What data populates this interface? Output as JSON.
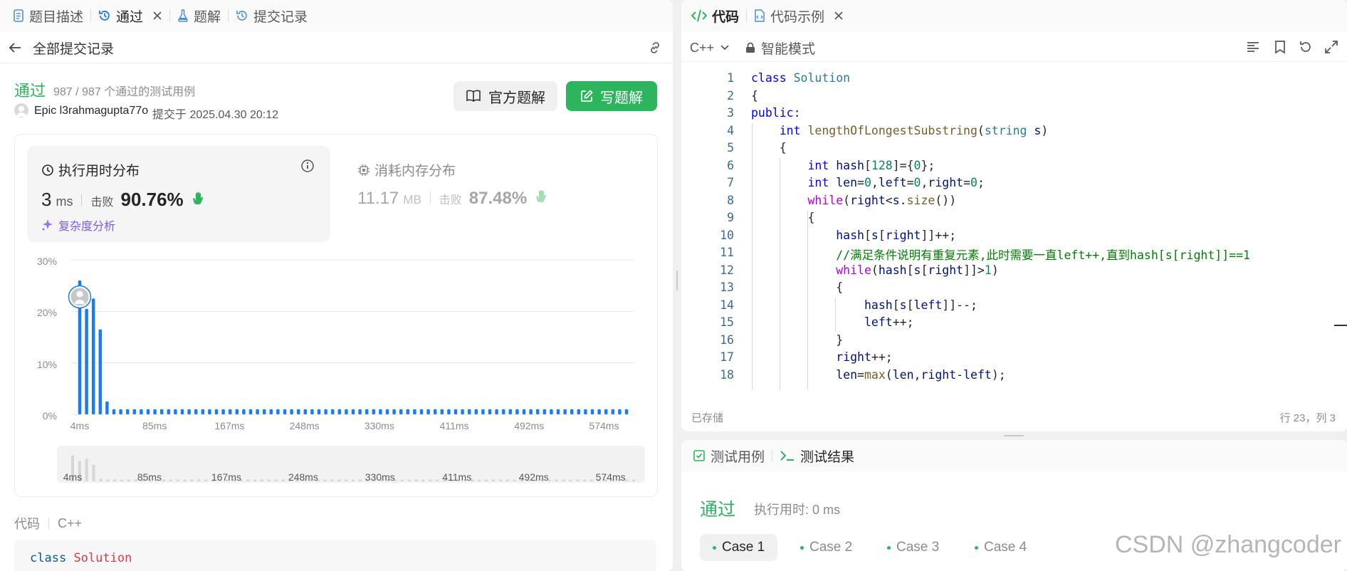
{
  "left": {
    "tabs": [
      {
        "label": "题目描述",
        "icon": "doc-icon"
      },
      {
        "label": "通过",
        "icon": "history-icon",
        "closable": true
      },
      {
        "label": "题解",
        "icon": "flask-icon"
      },
      {
        "label": "提交记录",
        "icon": "history-icon"
      }
    ],
    "header": {
      "back_label": "全部提交记录",
      "link_icon": "link-icon"
    },
    "result": {
      "status": "通过",
      "tests": "987 / 987 个通过的测试用例",
      "user": "Epic l3rahmagupta77o",
      "submitted": "提交于 2025.04.30 20:12",
      "official_btn": "官方题解",
      "write_btn": "写题解"
    },
    "runtime": {
      "title": "执行用时分布",
      "value": "3",
      "unit": "ms",
      "beat_label": "击败",
      "beat": "90.76%",
      "analysis": "复杂度分析"
    },
    "memory": {
      "title": "消耗内存分布",
      "value": "11.17",
      "unit": "MB",
      "beat_label": "击败",
      "beat": "87.48%"
    },
    "code_section": {
      "label": "代码",
      "lang": "C++",
      "first_line_kw": "class",
      "first_line_name": "Solution"
    }
  },
  "chart_data": {
    "type": "bar",
    "ylabel_ticks": [
      "30%",
      "20%",
      "10%",
      "0%"
    ],
    "ylim": [
      0,
      30
    ],
    "x_ticks": [
      "4ms",
      "85ms",
      "167ms",
      "248ms",
      "330ms",
      "411ms",
      "492ms",
      "574ms"
    ],
    "values": [
      26,
      20.5,
      22.5,
      16.5,
      2.5,
      1,
      1,
      1,
      1,
      1,
      1,
      1,
      1,
      1,
      1,
      1,
      1,
      1,
      1,
      1,
      1,
      1,
      1,
      1,
      1,
      1,
      1,
      1,
      1,
      1,
      1,
      1,
      1,
      1,
      1,
      1,
      1,
      1,
      1,
      1,
      1,
      1,
      1,
      1,
      1,
      1,
      1,
      1,
      1,
      1,
      1,
      1,
      1,
      1,
      1,
      1,
      1,
      1,
      1,
      1,
      1,
      1,
      1,
      1,
      1,
      1,
      1,
      1,
      1,
      1,
      1,
      1,
      1,
      1,
      1,
      1,
      1,
      1,
      1,
      1,
      1
    ],
    "user_bar_index": 0,
    "grid": true,
    "color": "#1a7cf0"
  },
  "editor": {
    "tabs": [
      {
        "label": "代码",
        "icon": "code-icon"
      },
      {
        "label": "代码示例",
        "icon": "code-file-icon",
        "closable": true
      }
    ],
    "lang": "C++",
    "mode": "智能模式",
    "status_saved": "已存储",
    "cursor_pos": "行 23，列 3",
    "line_numbers": [
      "1",
      "2",
      "3",
      "4",
      "5",
      "6",
      "7",
      "8",
      "9",
      "10",
      "11",
      "12",
      "13",
      "14",
      "15",
      "16",
      "17",
      "18"
    ]
  },
  "console": {
    "tabs": [
      {
        "label": "测试用例",
        "icon": "check-square-icon"
      },
      {
        "label": "测试结果",
        "icon": "terminal-icon"
      }
    ],
    "status": "通过",
    "runtime": "执行用时: 0 ms",
    "cases": [
      "Case 1",
      "Case 2",
      "Case 3",
      "Case 4"
    ]
  },
  "watermark": "CSDN @zhangcoder",
  "colors": {
    "accent_green": "#2db55d",
    "bar_blue": "#1a7cf0",
    "link_purple": "#7a5af8"
  }
}
